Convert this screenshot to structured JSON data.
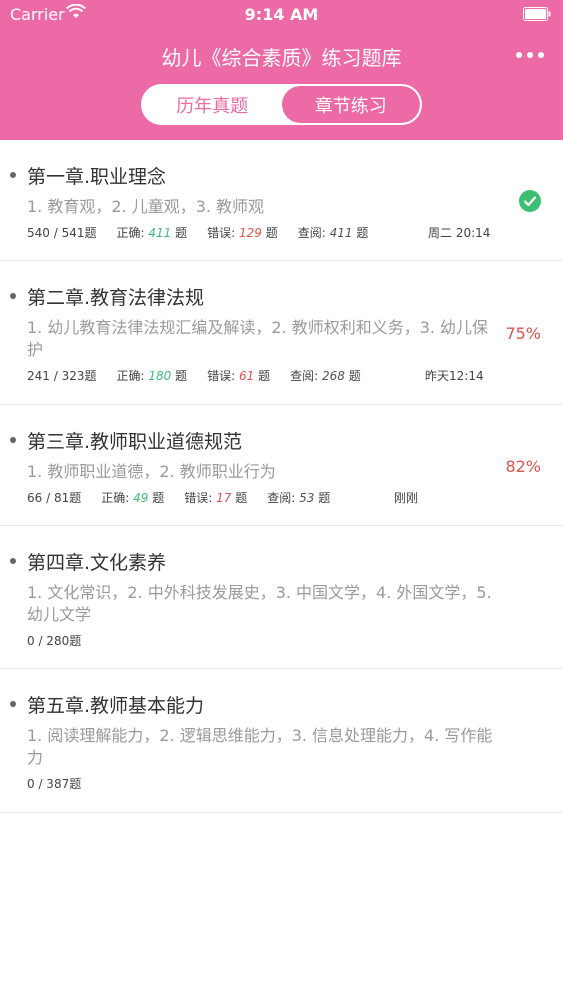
{
  "status_bar": {
    "carrier": "Carrier",
    "time": "9:14 AM"
  },
  "nav": {
    "title": "幼儿《综合素质》练习题库"
  },
  "segments": [
    {
      "label": "历年真题",
      "active": false
    },
    {
      "label": "章节练习",
      "active": true
    }
  ],
  "labels": {
    "correct": "正确:",
    "wrong": "错误:",
    "viewed": "查阅:",
    "unit": "题"
  },
  "chapters": [
    {
      "title": "第一章.职业理念",
      "desc": "1. 教育观，2. 儿童观，3. 教师观",
      "progress_text": "540 / 541题",
      "correct": "411",
      "wrong": "129",
      "viewed": "411",
      "time": "周二 20:14",
      "status": "complete",
      "percent": ""
    },
    {
      "title": "第二章.教育法律法规",
      "desc": "1. 幼儿教育法律法规汇编及解读，2. 教师权利和义务，3. 幼儿保护",
      "progress_text": "241 / 323题",
      "correct": "180",
      "wrong": "61",
      "viewed": "268",
      "time": "昨天12:14",
      "percent": "75%"
    },
    {
      "title": "第三章.教师职业道德规范",
      "desc": "1. 教师职业道德，2. 教师职业行为",
      "progress_text": "66 / 81题",
      "correct": "49",
      "wrong": "17",
      "viewed": "53",
      "time": "刚刚",
      "percent": "82%"
    },
    {
      "title": "第四章.文化素养",
      "desc": "1. 文化常识，2. 中外科技发展史，3. 中国文学，4. 外国文学，5. 幼儿文学",
      "progress_text": "0 / 280题"
    },
    {
      "title": "第五章.教师基本能力",
      "desc": "1. 阅读理解能力，2. 逻辑思维能力，3. 信息处理能力，4. 写作能力",
      "progress_text": "0 / 387题"
    }
  ],
  "colors": {
    "brand": "#ec6aa5",
    "correct": "#3cbf72",
    "wrong": "#e0544f"
  }
}
